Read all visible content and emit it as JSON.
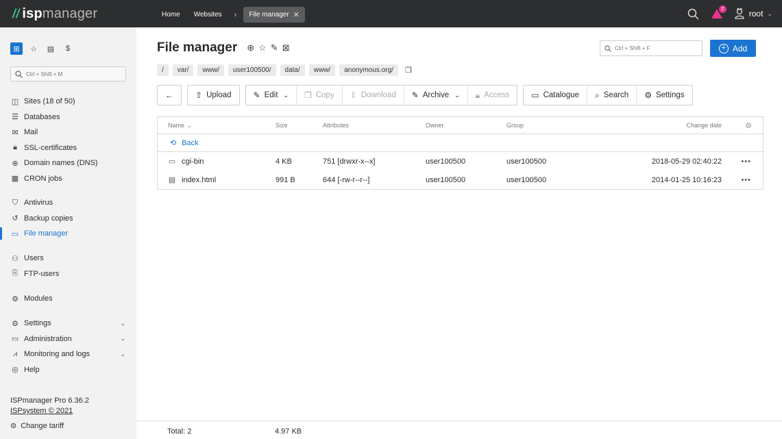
{
  "topbar": {
    "logo_prefix": "isp",
    "logo_suffix": "manager",
    "breadcrumbs": [
      "Home",
      "Websites"
    ],
    "active_tab": "File manager",
    "notification_count": "2",
    "user": "root"
  },
  "sidebar": {
    "search_placeholder": "Ctrl + Shift + M",
    "items": [
      {
        "label": "Sites (18 of 50)",
        "icon": "sites-icon"
      },
      {
        "label": "Databases",
        "icon": "database-icon"
      },
      {
        "label": "Mail",
        "icon": "mail-icon"
      },
      {
        "label": "SSL-certificates",
        "icon": "lock-icon"
      },
      {
        "label": "Domain names (DNS)",
        "icon": "globe-icon"
      },
      {
        "label": "CRON jobs",
        "icon": "calendar-icon"
      },
      {
        "label": "Antivirus",
        "icon": "shield-icon"
      },
      {
        "label": "Backup copies",
        "icon": "backup-icon"
      },
      {
        "label": "File manager",
        "icon": "folder-icon"
      },
      {
        "label": "Users",
        "icon": "user-icon"
      },
      {
        "label": "FTP-users",
        "icon": "ftp-icon"
      },
      {
        "label": "Modules",
        "icon": "modules-icon"
      },
      {
        "label": "Settings",
        "icon": "gear-icon"
      },
      {
        "label": "Administration",
        "icon": "monitor-icon"
      },
      {
        "label": "Monitoring and logs",
        "icon": "chart-icon"
      },
      {
        "label": "Help",
        "icon": "help-icon"
      }
    ],
    "version": "ISPmanager Pro 6.36.2",
    "copyright": "ISPsystem © 2021",
    "change_tariff": "Change tariff"
  },
  "main": {
    "title": "File manager",
    "search_placeholder": "Ctrl + Shift + F",
    "add_label": "Add",
    "path": [
      "/",
      "var/",
      "www/",
      "user100500/",
      "data/",
      "www/",
      "anonymous.org/"
    ],
    "toolbar": {
      "upload": "Upload",
      "edit": "Edit",
      "copy": "Copy",
      "download": "Download",
      "archive": "Archive",
      "access": "Access",
      "catalogue": "Catalogue",
      "search": "Search",
      "settings": "Settings"
    },
    "columns": {
      "name": "Name",
      "size": "Size",
      "attributes": "Attributes",
      "owner": "Owner",
      "group": "Group",
      "change_date": "Change date"
    },
    "back_label": "Back",
    "rows": [
      {
        "name": "cgi-bin",
        "size": "4 KB",
        "attributes": "751 [drwxr-x--x]",
        "owner": "user100500",
        "group": "user100500",
        "date": "2018-05-29 02:40:22"
      },
      {
        "name": "index.html",
        "size": "991 B",
        "attributes": "644 [-rw-r--r--]",
        "owner": "user100500",
        "group": "user100500",
        "date": "2014-01-25 10:16:23"
      }
    ],
    "footer": {
      "total": "Total: 2",
      "size": "4.97 KB"
    }
  }
}
